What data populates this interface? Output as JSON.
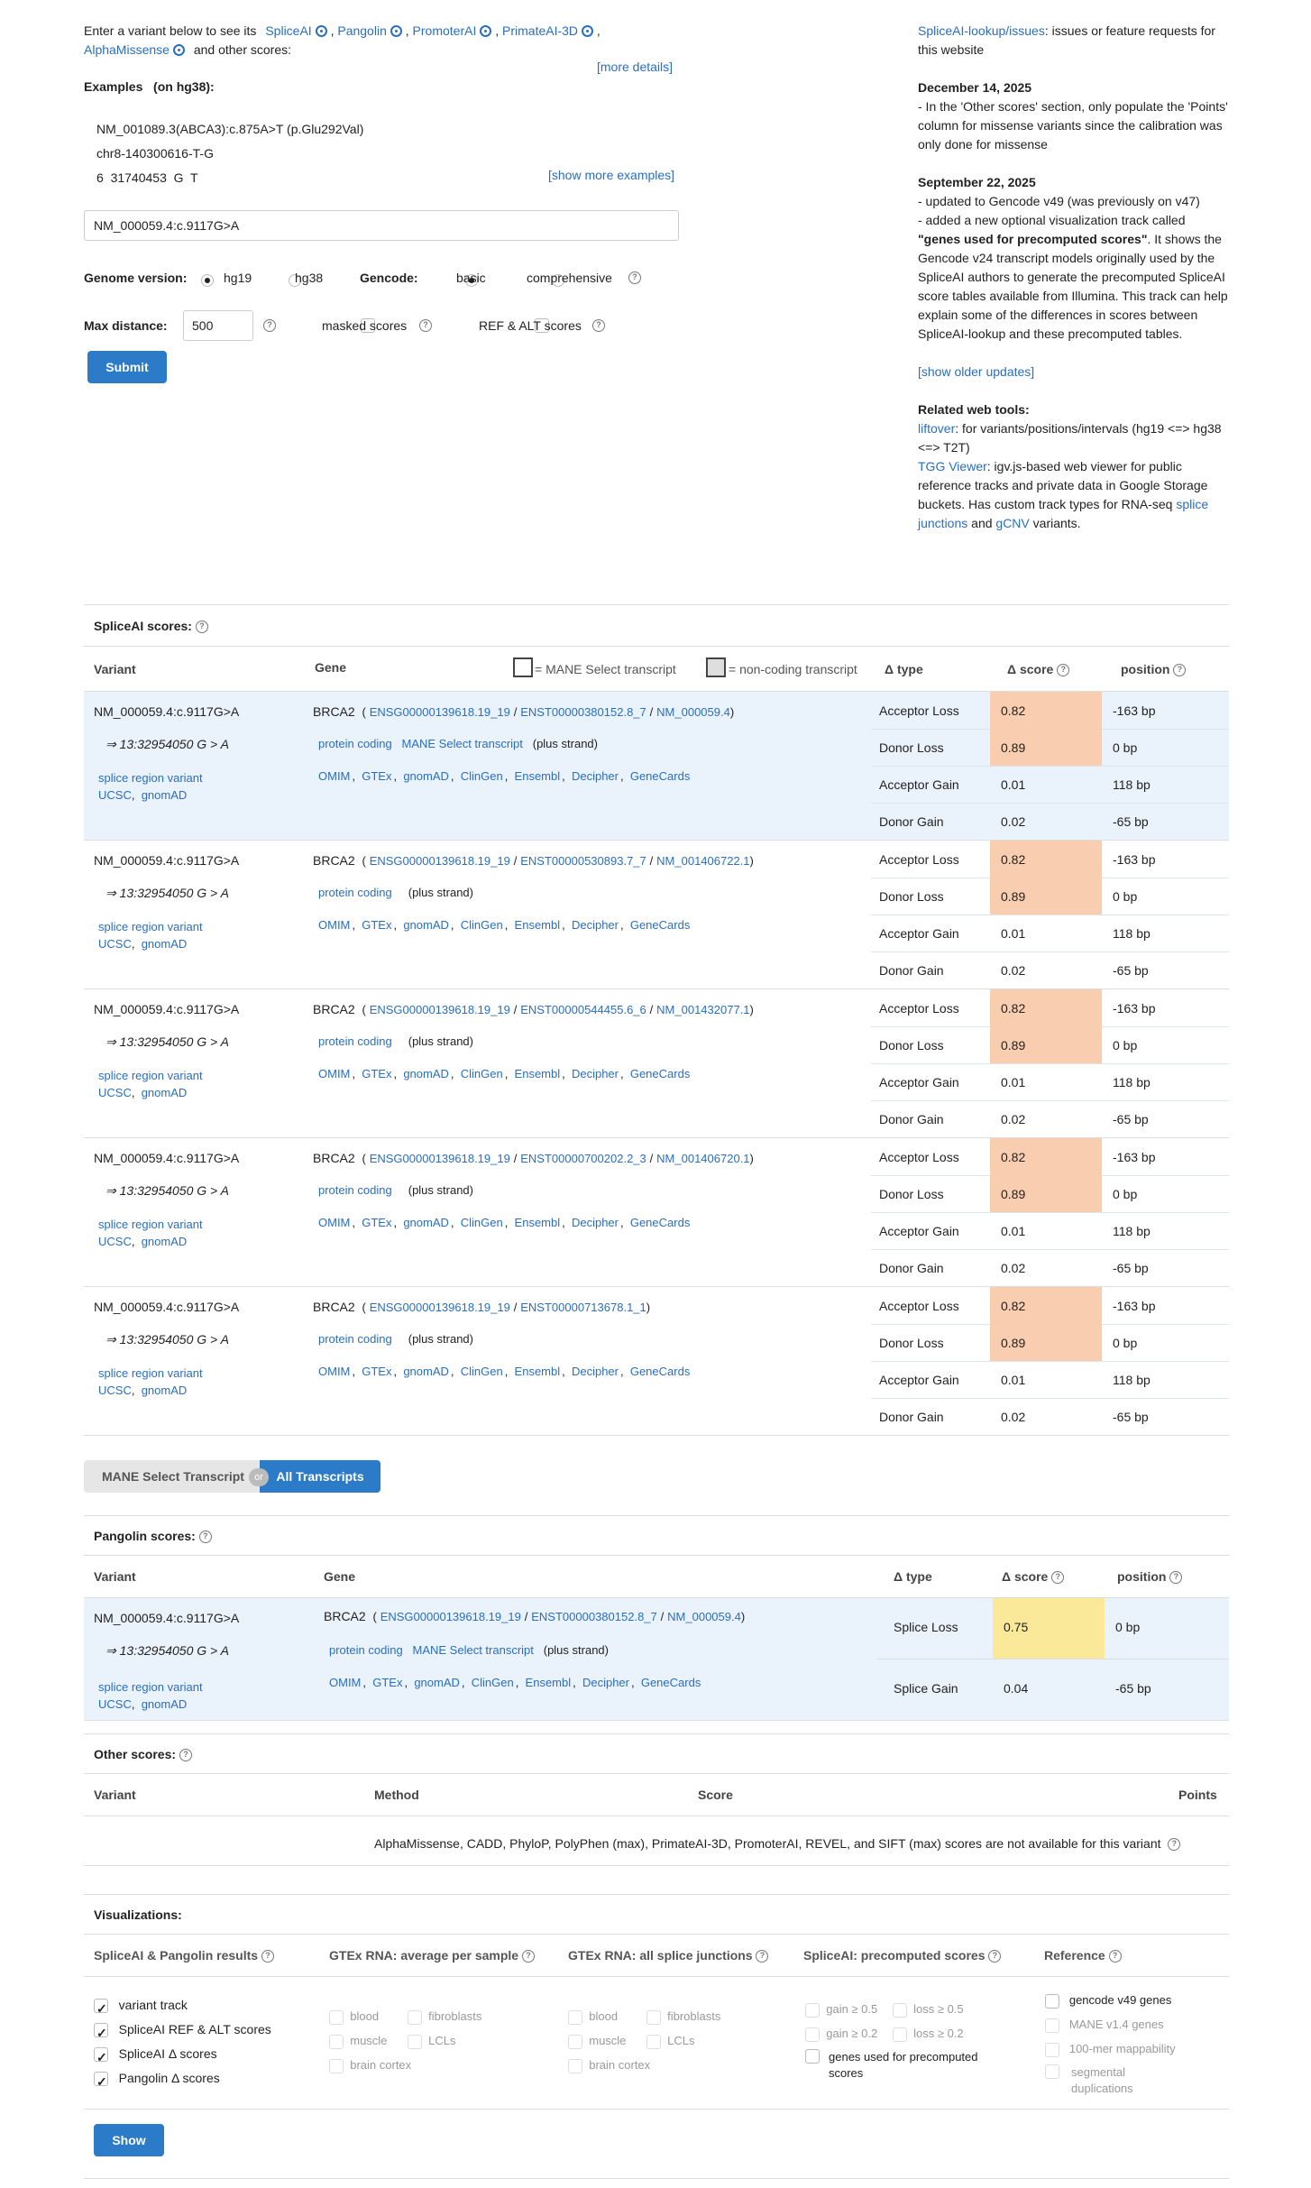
{
  "intro": {
    "prefix": "Enter a variant below to see its",
    "tools": [
      "SpliceAI",
      "Pangolin",
      "PromoterAI",
      "PrimateAI-3D",
      "AlphaMissense"
    ],
    "suffix": "and other scores:",
    "more_details": "[more details]"
  },
  "examples": {
    "title": "Examples",
    "build": "(on hg38):",
    "items": [
      "NM_001089.3(ABCA3):c.875A>T (p.Glu292Val)",
      "chr8-140300616-T-G",
      "6  31740453  G  T"
    ],
    "show_more": "[show more examples]"
  },
  "input": {
    "value": "NM_000059.4:c.9117G>A"
  },
  "genome": {
    "label": "Genome version:",
    "opt1": "hg19",
    "opt2": "hg38",
    "selected": "hg19"
  },
  "gencode": {
    "label": "Gencode:",
    "opt1": "basic",
    "opt2": "comprehensive",
    "selected": "basic"
  },
  "maxdist": {
    "label": "Max distance:",
    "value": "500",
    "masked": "masked scores",
    "refalt": "REF & ALT scores"
  },
  "submit": "Submit",
  "news": {
    "issues_link": "SpliceAI-lookup/issues",
    "issues_text": ": issues or feature requests for this website",
    "date1": "December 14, 2025",
    "text1": "- In the 'Other scores' section, only populate the 'Points' column for missense variants since the calibration was only done for missense",
    "date2": "September 22, 2025",
    "text2a": "- updated to Gencode v49 (was previously on v47)",
    "text2b": "- added a new optional visualization track called",
    "text2c": "\"genes used for precomputed scores\"",
    "text2d": ". It shows the Gencode v24 transcript models originally used by the SpliceAI authors to generate the precomputed SpliceAI score tables available from Illumina. This track can help explain some of the differences in scores between SpliceAI-lookup and these precomputed tables.",
    "older": "[show older updates]",
    "related": "Related web tools:",
    "liftover": "liftover",
    "liftover_text": ": for variants/positions/intervals (hg19 <=> hg38 <=> T2T)",
    "tgg": "TGG Viewer",
    "tgg_text": ": igv.js-based web viewer for public reference tracks and private data in Google Storage buckets. Has custom track types for RNA-seq",
    "splice_junctions": "splice junctions",
    "and": "and",
    "gcnv": "gCNV",
    "variants": "variants."
  },
  "spliceai": {
    "title": "SpliceAI scores:",
    "headers": {
      "variant": "Variant",
      "gene": "Gene",
      "mane": "= MANE Select transcript",
      "noncoding": "= non-coding transcript",
      "dtype": "Δ type",
      "dscore": "Δ score",
      "position": "position"
    },
    "rows": [
      {
        "variant": "NM_000059.4:c.9117G>A",
        "pos": "⇒ 13:32954050 G > A",
        "gene": "BRCA2",
        "ensg": "ENSG00000139618.19_19",
        "enst": "ENST00000380152.8_7",
        "nm": "NM_000059.4",
        "biotype": "protein coding",
        "mane": "MANE Select transcript",
        "strand": "(plus strand)",
        "types": [
          "Acceptor Loss",
          "Donor Loss",
          "Acceptor Gain",
          "Donor Gain"
        ],
        "scores": [
          "0.82",
          "0.89",
          "0.01",
          "0.02"
        ],
        "positions": [
          "-163 bp",
          "0 bp",
          "118 bp",
          "-65 bp"
        ]
      },
      {
        "variant": "NM_000059.4:c.9117G>A",
        "pos": "⇒ 13:32954050 G > A",
        "gene": "BRCA2",
        "ensg": "ENSG00000139618.19_19",
        "enst": "ENST00000530893.7_7",
        "nm": "NM_001406722.1",
        "biotype": "protein coding",
        "mane": "",
        "strand": "(plus strand)",
        "types": [
          "Acceptor Loss",
          "Donor Loss",
          "Acceptor Gain",
          "Donor Gain"
        ],
        "scores": [
          "0.82",
          "0.89",
          "0.01",
          "0.02"
        ],
        "positions": [
          "-163 bp",
          "0 bp",
          "118 bp",
          "-65 bp"
        ]
      },
      {
        "variant": "NM_000059.4:c.9117G>A",
        "pos": "⇒ 13:32954050 G > A",
        "gene": "BRCA2",
        "ensg": "ENSG00000139618.19_19",
        "enst": "ENST00000544455.6_6",
        "nm": "NM_001432077.1",
        "biotype": "protein coding",
        "mane": "",
        "strand": "(plus strand)",
        "types": [
          "Acceptor Loss",
          "Donor Loss",
          "Acceptor Gain",
          "Donor Gain"
        ],
        "scores": [
          "0.82",
          "0.89",
          "0.01",
          "0.02"
        ],
        "positions": [
          "-163 bp",
          "0 bp",
          "118 bp",
          "-65 bp"
        ]
      },
      {
        "variant": "NM_000059.4:c.9117G>A",
        "pos": "⇒ 13:32954050 G > A",
        "gene": "BRCA2",
        "ensg": "ENSG00000139618.19_19",
        "enst": "ENST00000700202.2_3",
        "nm": "NM_001406720.1",
        "biotype": "protein coding",
        "mane": "",
        "strand": "(plus strand)",
        "types": [
          "Acceptor Loss",
          "Donor Loss",
          "Acceptor Gain",
          "Donor Gain"
        ],
        "scores": [
          "0.82",
          "0.89",
          "0.01",
          "0.02"
        ],
        "positions": [
          "-163 bp",
          "0 bp",
          "118 bp",
          "-65 bp"
        ]
      },
      {
        "variant": "NM_000059.4:c.9117G>A",
        "pos": "⇒ 13:32954050 G > A",
        "gene": "BRCA2",
        "ensg": "ENSG00000139618.19_19",
        "enst": "ENST00000713678.1_1",
        "nm": "",
        "biotype": "protein coding",
        "mane": "",
        "strand": "(plus strand)",
        "types": [
          "Acceptor Loss",
          "Donor Loss",
          "Acceptor Gain",
          "Donor Gain"
        ],
        "scores": [
          "0.82",
          "0.89",
          "0.01",
          "0.02"
        ],
        "positions": [
          "-163 bp",
          "0 bp",
          "118 bp",
          "-65 bp"
        ]
      }
    ],
    "links": {
      "splice": "splice region variant",
      "ucsc": "UCSC",
      "gnomad": "gnomAD",
      "resources": [
        "OMIM",
        "GTEx",
        "gnomAD",
        "ClinGen",
        "Ensembl",
        "Decipher",
        "GeneCards"
      ]
    }
  },
  "toggle": {
    "mane": "MANE Select Transcript",
    "or": "or",
    "all": "All Transcripts"
  },
  "pangolin": {
    "title": "Pangolin scores:",
    "headers": {
      "variant": "Variant",
      "gene": "Gene",
      "dtype": "Δ type",
      "dscore": "Δ score",
      "position": "position"
    },
    "row": {
      "variant": "NM_000059.4:c.9117G>A",
      "pos": "⇒ 13:32954050 G > A",
      "gene": "BRCA2",
      "ensg": "ENSG00000139618.19_19",
      "enst": "ENST00000380152.8_7",
      "nm": "NM_000059.4",
      "biotype": "protein coding",
      "mane": "MANE Select transcript",
      "strand": "(plus strand)",
      "types": [
        "Splice Loss",
        "Splice Gain"
      ],
      "scores": [
        "0.75",
        "0.04"
      ],
      "positions": [
        "0 bp",
        "-65 bp"
      ]
    }
  },
  "other": {
    "title": "Other scores:",
    "headers": {
      "variant": "Variant",
      "method": "Method",
      "score": "Score",
      "points": "Points"
    },
    "message": "AlphaMissense,  CADD,  PhyloP,  PolyPhen (max),  PrimateAI-3D,  PromoterAI,  REVEL,  and SIFT (max) scores are not available for this variant"
  },
  "viz": {
    "title": "Visualizations:",
    "col1": {
      "title": "SpliceAI & Pangolin results",
      "items": [
        "variant track",
        "SpliceAI REF & ALT scores",
        "SpliceAI Δ scores",
        "Pangolin Δ  scores"
      ]
    },
    "col2": {
      "title": "GTEx RNA: average per sample",
      "items": [
        "blood",
        "fibroblasts",
        "muscle",
        "LCLs",
        "brain cortex"
      ]
    },
    "col3": {
      "title": "GTEx RNA: all splice junctions",
      "items": [
        "blood",
        "fibroblasts",
        "muscle",
        "LCLs",
        "brain cortex"
      ]
    },
    "col4": {
      "title": "SpliceAI: precomputed scores",
      "items": [
        "gain ≥ 0.5",
        "loss ≥ 0.5",
        "gain ≥ 0.2",
        "loss ≥ 0.2",
        "genes used for precomputed scores"
      ]
    },
    "col5": {
      "title": "Reference",
      "items": [
        "gencode v49 genes",
        "MANE v1.4 genes",
        "100-mer mappability",
        "segmental duplications"
      ]
    },
    "show": "Show"
  },
  "colors": {
    "link": "#2a6ebf",
    "button": "#2b7bc9",
    "highlight_row": "#eaf2fc",
    "orange": "#f8cdb0",
    "yellow": "#fbe99a"
  }
}
